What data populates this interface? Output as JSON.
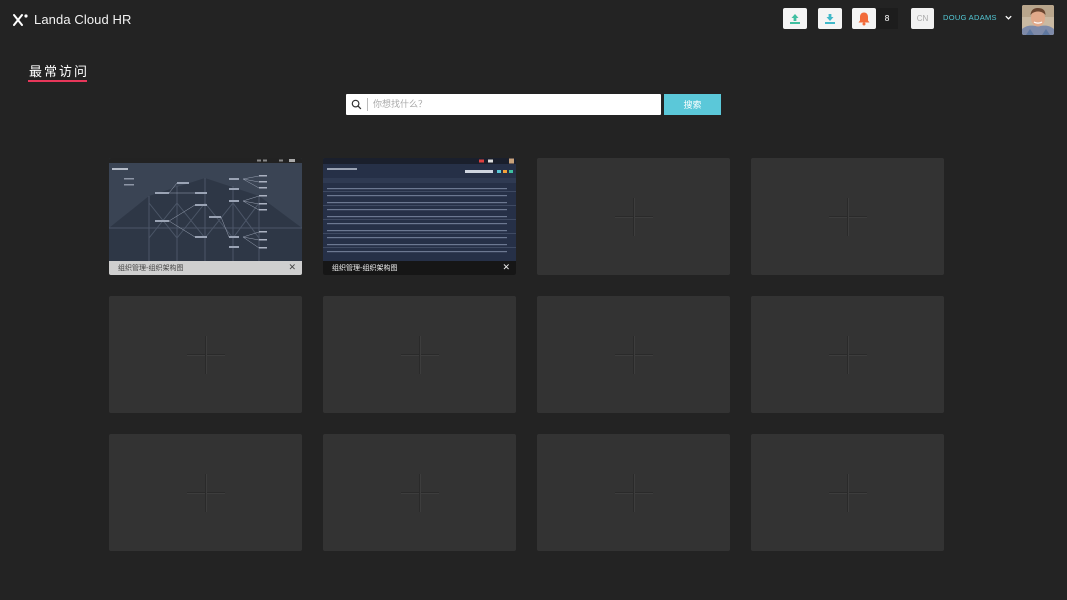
{
  "app": {
    "title": "Landa Cloud HR"
  },
  "header": {
    "upload_icon": "upload-icon",
    "download_icon": "download-icon",
    "bell_icon": "bell-icon",
    "notification_count": "8",
    "language": "CN",
    "user_name": "DOUG ADAMS",
    "accent_color": "#53c9d6",
    "bell_color": "#f26b3a"
  },
  "main": {
    "title": "最常访问",
    "title_underline_color": "#e8375a",
    "search": {
      "placeholder": "你想找什么？",
      "value": "",
      "button_label": "搜索"
    },
    "tiles": [
      {
        "caption": "组织管理-组织架构图",
        "state": "light"
      },
      {
        "caption": "组织管理-组织架构图",
        "state": "dark"
      },
      {
        "caption": "",
        "state": "empty"
      },
      {
        "caption": "",
        "state": "empty"
      },
      {
        "caption": "",
        "state": "empty"
      },
      {
        "caption": "",
        "state": "empty"
      },
      {
        "caption": "",
        "state": "empty"
      },
      {
        "caption": "",
        "state": "empty"
      },
      {
        "caption": "",
        "state": "empty"
      },
      {
        "caption": "",
        "state": "empty"
      },
      {
        "caption": "",
        "state": "empty"
      },
      {
        "caption": "",
        "state": "empty"
      }
    ],
    "add_icon": "plus-icon",
    "close_icon": "close-icon"
  }
}
